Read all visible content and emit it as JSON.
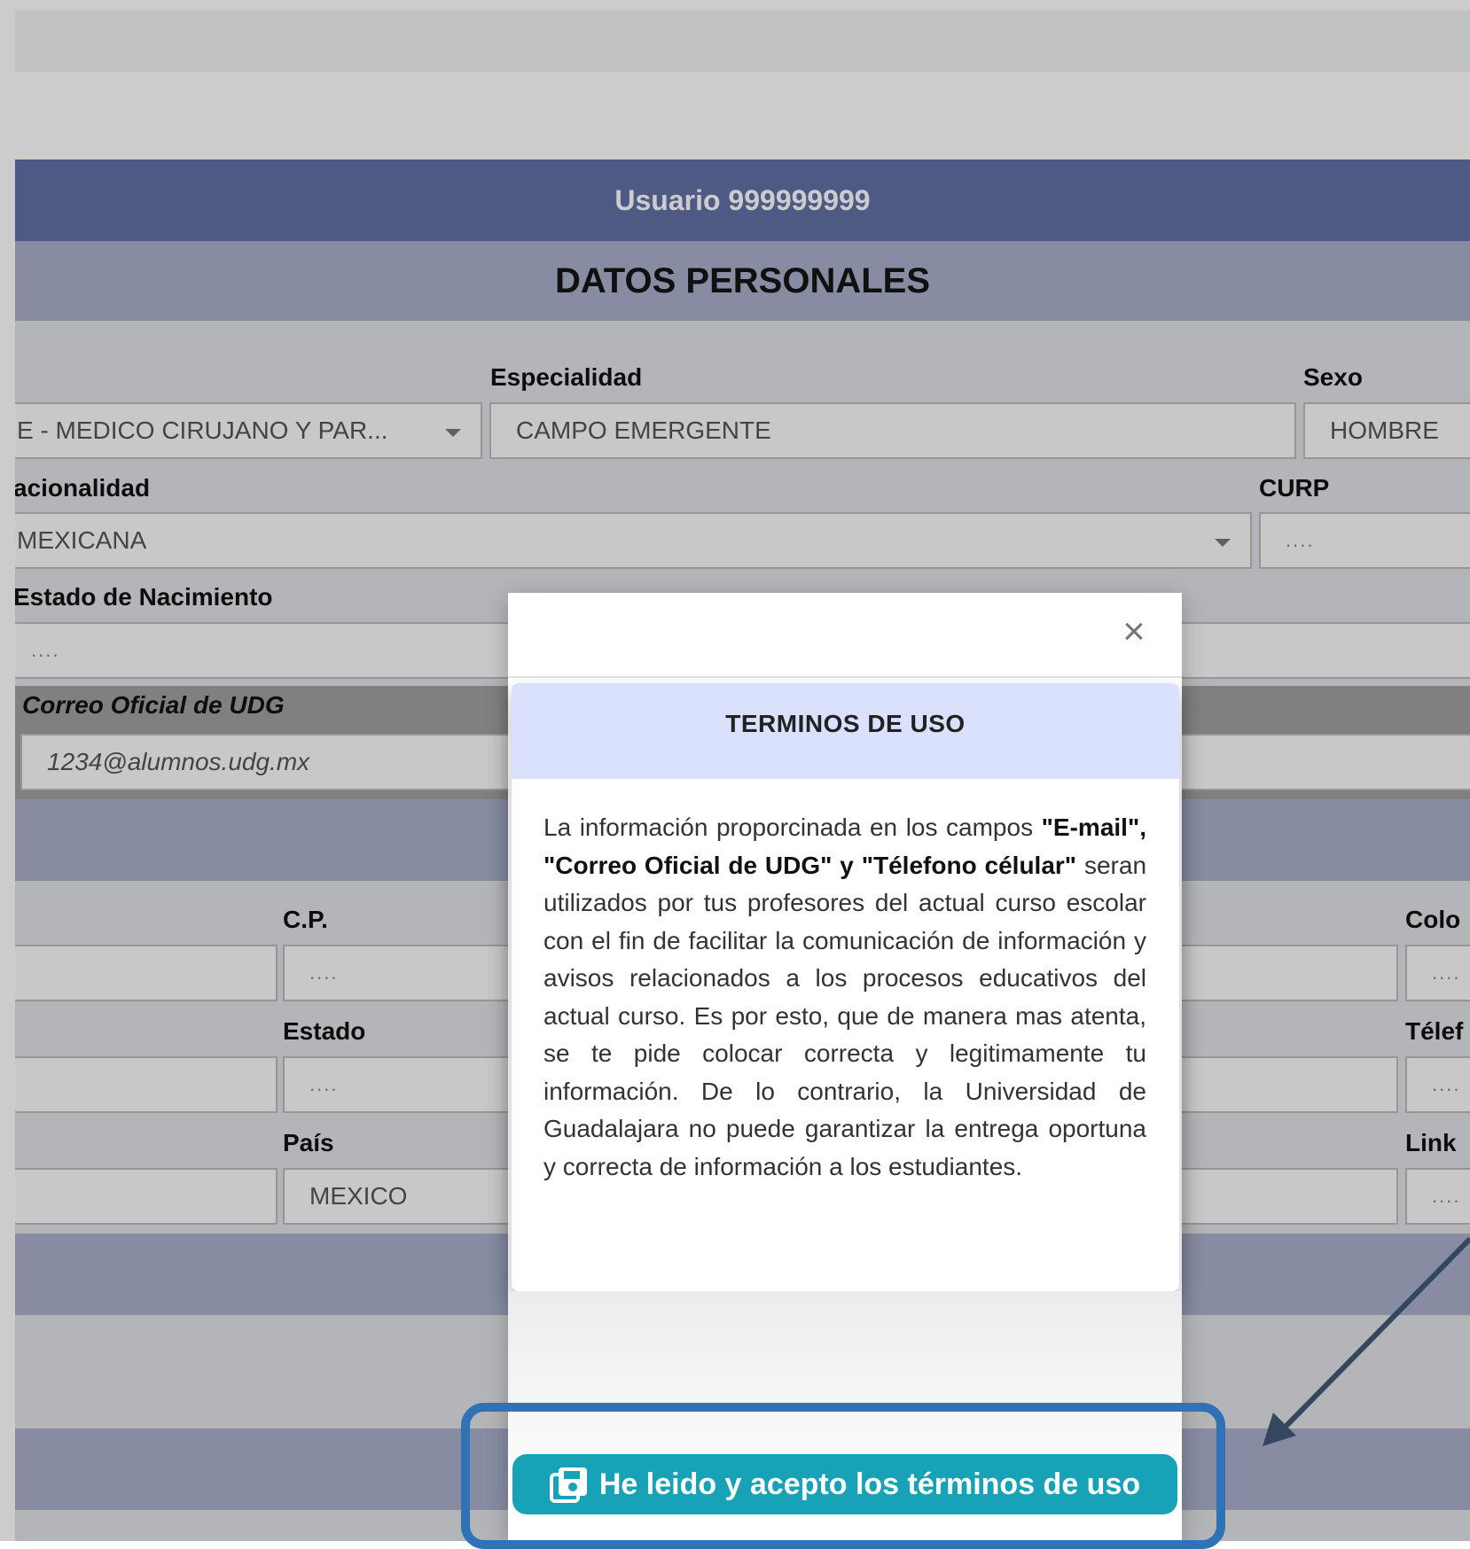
{
  "header": {
    "user_title": "Usuario 999999999"
  },
  "section": {
    "title": "DATOS PERSONALES"
  },
  "form": {
    "carrera_value": "E - MEDICO CIRUJANO Y PAR...",
    "especialidad": {
      "label": "Especialidad",
      "value": "CAMPO EMERGENTE"
    },
    "sexo": {
      "label": "Sexo",
      "value": "HOMBRE"
    },
    "nacionalidad": {
      "label": "acionalidad",
      "value": "MEXICANA"
    },
    "curp": {
      "label": "CURP",
      "value": "...."
    },
    "estado_nacimiento": {
      "label": "Estado de Nacimiento",
      "value": "...."
    },
    "correo_oficial": {
      "label": "Correo Oficial de UDG",
      "value": "1234@alumnos.udg.mx"
    },
    "cp": {
      "label": "C.P.",
      "value": "...."
    },
    "colonia": {
      "label": "Colo",
      "value": "...."
    },
    "estado": {
      "label": "Estado",
      "value": "...."
    },
    "telefono": {
      "label": "Télef",
      "value": "...."
    },
    "pais": {
      "label": "País",
      "value": "MEXICO"
    },
    "link": {
      "label": "Link",
      "value": "...."
    }
  },
  "modal": {
    "close_symbol": "×",
    "title": "TERMINOS DE USO",
    "text_intro": "La información proporcinada en los campos",
    "text_bold": "\"E-mail\", \"Correo Oficial de UDG\" y \"Télefono célular\"",
    "text_rest": "seran utilizados por tus profesores del actual curso escolar con el fin de facilitar la comunicación de información y avisos relacionados a los procesos educativos del actual curso. Es por esto, que de manera mas atenta, se te pide colocar correcta y legitimamente tu información. De lo contrario, la Universidad de Guadalajara no puede garantizar la entrega oportuna y correcta de información a los estudiantes.",
    "accept_label": "He leido y acepto los términos de uso"
  },
  "colors": {
    "header_blue": "#6271a5",
    "section_band": "#a9b0cb",
    "modal_header": "#d9e1fd",
    "accept_button": "#17a2b8",
    "highlight_box": "#2f73b5",
    "arrow": "#354760"
  },
  "icons": {
    "accept": "save-icon",
    "close": "close-icon"
  }
}
